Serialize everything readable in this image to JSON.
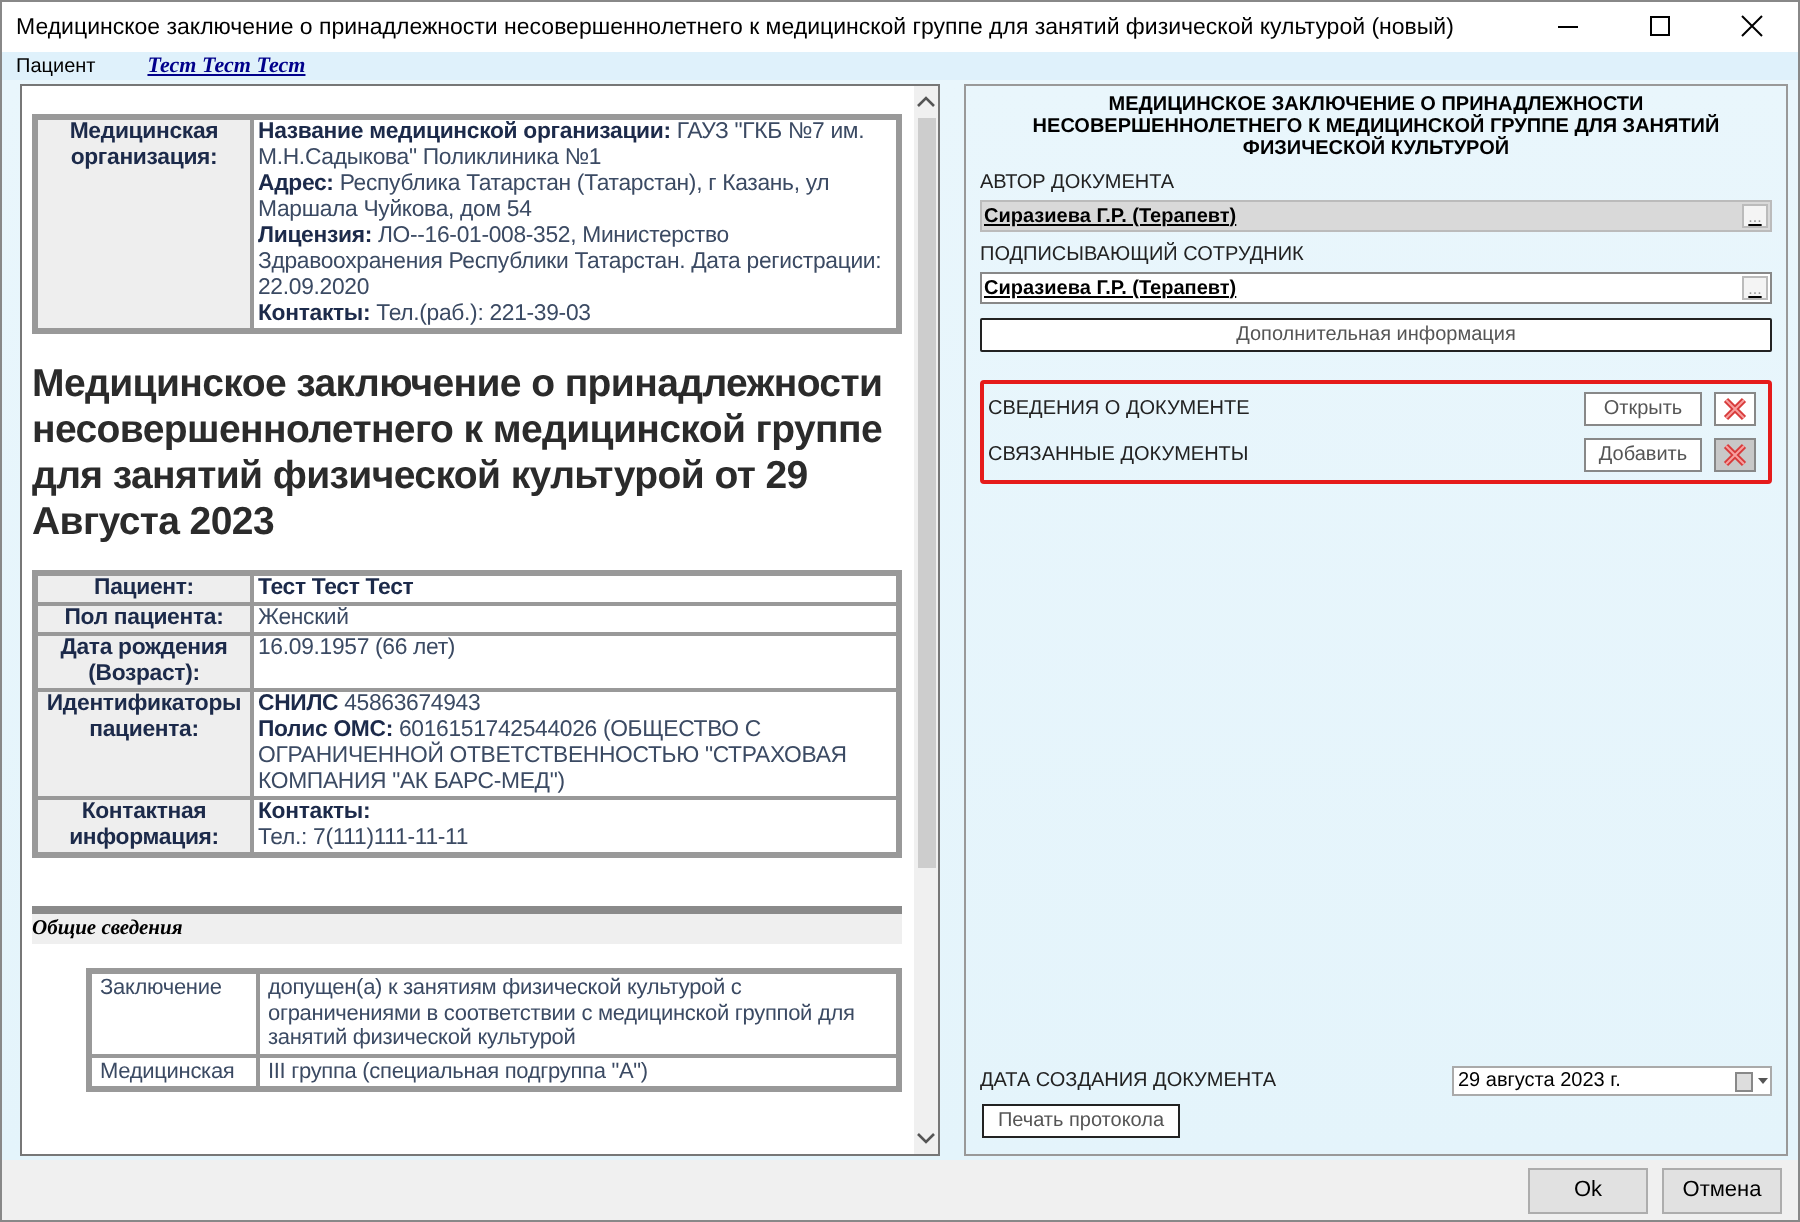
{
  "window": {
    "title": "Медицинское заключение о принадлежности несовершеннолетнего к медицинской группе для занятий физической культурой (новый)"
  },
  "patient_bar": {
    "label": "Пациент",
    "link": "Тест Тест Тест"
  },
  "document": {
    "org_table": {
      "label": "Медицинская организация:",
      "lines": [
        "**Название медицинской организации:** ГАУЗ \"ГКБ №7 им. М.Н.Садыкова\" Поликлиника №1",
        "**Адрес:** Республика Татарстан (Татарстан), г Казань, ул Маршала Чуйкова, дом 54",
        "**Лицензия:** ЛО--16-01-008-352, Министерство Здравоохранения Республики Татарстан. Дата регистрации: 22.09.2020",
        "**Контакты:** Тел.(раб.): 221-39-03"
      ]
    },
    "heading": "Медицинское заключение о принадлежности несовершеннолетнего к медицинской группе для занятий физической культурой от 29 Августа 2023",
    "patient_table": [
      {
        "label": "Пациент:",
        "lines": [
          "**Тест Тест Тест**"
        ]
      },
      {
        "label": "Пол пациента:",
        "lines": [
          "Женский"
        ]
      },
      {
        "label": "Дата рождения (Возраст):",
        "lines": [
          "16.09.1957 (66 лет)"
        ]
      },
      {
        "label": "Идентификаторы пациента:",
        "lines": [
          "**СНИЛС** 45863674943",
          "**Полис ОМС:** 6016151742544026 (ОБЩЕСТВО С ОГРАНИЧЕННОЙ ОТВЕТСТВЕННОСТЬЮ \"СТРАХОВАЯ КОМПАНИЯ \"АК БАРС-МЕД\")"
        ]
      },
      {
        "label": "Контактная информация:",
        "lines": [
          "**Контакты:**",
          "Тел.: 7(111)111-11-11"
        ]
      }
    ],
    "section_title": "Общие сведения",
    "conclusion_table": [
      {
        "label": "Заключение",
        "value": "допущен(а) к занятиям физической культурой с ограничениями в соответствии с медицинской группой для занятий физической культурой"
      },
      {
        "label": "Медицинская",
        "value": "III группа (специальная подгруппа \"А\")"
      }
    ]
  },
  "panel": {
    "title": "МЕДИЦИНСКОЕ ЗАКЛЮЧЕНИЕ О ПРИНАДЛЕЖНОСТИ НЕСОВЕРШЕННОЛЕТНЕГО К МЕДИЦИНСКОЙ ГРУППЕ ДЛЯ ЗАНЯТИЙ ФИЗИЧЕСКОЙ КУЛЬТУРОЙ",
    "fields": [
      {
        "label": "АВТОР ДОКУМЕНТА",
        "value": "Сиразиева Г.Р. (Терапевт)",
        "button": "...",
        "disabled": true
      },
      {
        "label": "ПОДПИСЫВАЮЩИЙ СОТРУДНИК",
        "value": "Сиразиева Г.Р. (Терапевт)",
        "button": "...",
        "disabled": false
      }
    ],
    "extra_button": "Дополнительная информация",
    "sections": [
      {
        "label": "СВЕДЕНИЯ О ДОКУМЕНТЕ",
        "button": "Открыть",
        "highlighted": false
      },
      {
        "label": "СВЯЗАННЫЕ ДОКУМЕНТЫ",
        "button": "Добавить",
        "highlighted": true
      }
    ],
    "date_label": "ДАТА СОЗДАНИЯ ДОКУМЕНТА",
    "date_value": "29  августа  2023 г.",
    "print_button": "Печать протокола"
  },
  "buttons": [
    "Ok",
    "Отмена"
  ]
}
